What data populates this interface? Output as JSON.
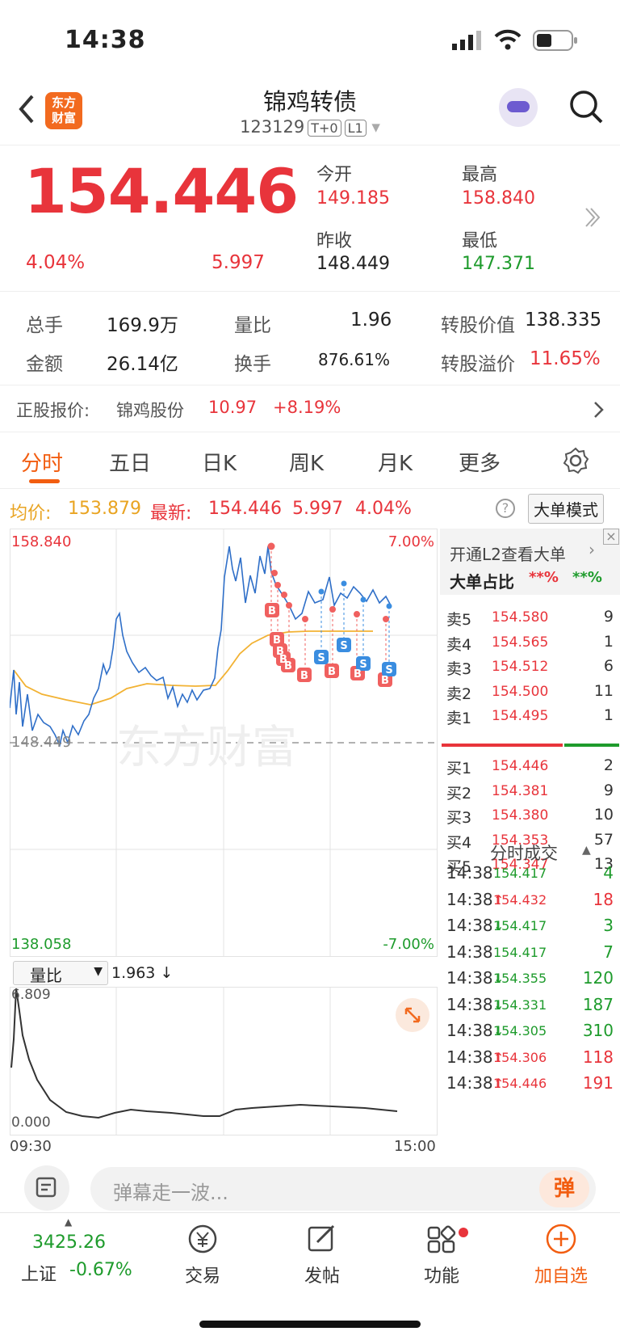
{
  "status": {
    "time": "14:38"
  },
  "header": {
    "title": "锦鸡转债",
    "code": "123129",
    "tag1": "T+0",
    "tag2": "L1",
    "logo_line1": "东方",
    "logo_line2": "财富"
  },
  "quote": {
    "price": "154.446",
    "pct": "4.04%",
    "chg": "5.997",
    "open_label": "今开",
    "open": "149.185",
    "high_label": "最高",
    "high": "158.840",
    "prev_label": "昨收",
    "prev": "148.449",
    "low_label": "最低",
    "low": "147.371"
  },
  "stats": {
    "vol_l": "总手",
    "vol": "169.9万",
    "ratio_l": "量比",
    "ratio": "1.96",
    "conv_l": "转股价值",
    "conv": "138.335",
    "amt_l": "金额",
    "amt": "26.14亿",
    "turn_l": "换手",
    "turn": "876.61%",
    "prem_l": "转股溢价",
    "prem": "11.65%"
  },
  "underlying": {
    "label": "正股报价:",
    "name": "锦鸡股份",
    "price": "10.97",
    "pct": "+8.19%"
  },
  "tabs": [
    "分时",
    "五日",
    "日K",
    "周K",
    "月K",
    "更多"
  ],
  "indicator": {
    "avg_label": "均价:",
    "avg": "153.879",
    "last_label": "最新:",
    "last": "154.446",
    "chg": "5.997",
    "pct": "4.04%",
    "mode": "大单模式"
  },
  "chart": {
    "top": "158.840",
    "bottom": "138.058",
    "top_pct": "7.00%",
    "bot_pct": "-7.00%",
    "mid": "148.449",
    "watermark": "东方财富",
    "time_start": "09:30",
    "time_end": "15:00"
  },
  "volume": {
    "label": "量比",
    "value": "1.963",
    "arrow": "↓",
    "top": "6.809",
    "bottom": "0.000"
  },
  "book": {
    "l2": "开通L2查看大单",
    "ratio_label": "大单占比",
    "r1": "**%",
    "r2": "**%",
    "asks": [
      {
        "l": "卖5",
        "p": "154.580",
        "v": "9"
      },
      {
        "l": "卖4",
        "p": "154.565",
        "v": "1"
      },
      {
        "l": "卖3",
        "p": "154.512",
        "v": "6"
      },
      {
        "l": "卖2",
        "p": "154.500",
        "v": "11"
      },
      {
        "l": "卖1",
        "p": "154.495",
        "v": "1"
      }
    ],
    "bids": [
      {
        "l": "买1",
        "p": "154.446",
        "v": "2"
      },
      {
        "l": "买2",
        "p": "154.381",
        "v": "9"
      },
      {
        "l": "买3",
        "p": "154.380",
        "v": "10"
      },
      {
        "l": "买4",
        "p": "154.353",
        "v": "57"
      },
      {
        "l": "买5",
        "p": "154.347",
        "v": "13"
      }
    ],
    "trades_label": "分时成交",
    "trades": [
      {
        "t": "14:38",
        "p": "154.417",
        "a": "",
        "v": "4",
        "c": "green"
      },
      {
        "t": "14:38",
        "p": "154.432",
        "a": "↑",
        "v": "18",
        "c": "red"
      },
      {
        "t": "14:38",
        "p": "154.417",
        "a": "↓",
        "v": "3",
        "c": "green"
      },
      {
        "t": "14:38",
        "p": "154.417",
        "a": "",
        "v": "7",
        "c": "green"
      },
      {
        "t": "14:38",
        "p": "154.355",
        "a": "↓",
        "v": "120",
        "c": "green"
      },
      {
        "t": "14:38",
        "p": "154.331",
        "a": "↓",
        "v": "187",
        "c": "green"
      },
      {
        "t": "14:38",
        "p": "154.305",
        "a": "↓",
        "v": "310",
        "c": "green"
      },
      {
        "t": "14:38",
        "p": "154.306",
        "a": "↑",
        "v": "118",
        "c": "red"
      },
      {
        "t": "14:38",
        "p": "154.446",
        "a": "↑",
        "v": "191",
        "c": "red"
      }
    ]
  },
  "comment": {
    "placeholder": "弹幕走一波...",
    "btn": "弹"
  },
  "nav": {
    "index": "3425.26",
    "index_name": "上证",
    "index_pct": "-0.67%",
    "trade": "交易",
    "post": "发帖",
    "func": "功能",
    "add": "加自选"
  }
}
